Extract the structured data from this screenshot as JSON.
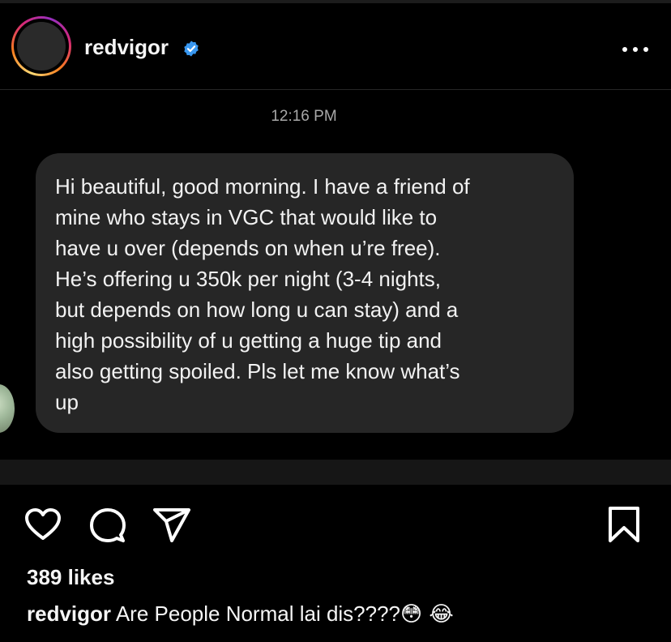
{
  "post": {
    "username": "redvigor",
    "verified": true
  },
  "message": {
    "timestamp": "12:16 PM",
    "text": "Hi beautiful, good morning. I have a friend of\nmine who stays in VGC that would like to\nhave u over (depends on when u’re free).\nHe’s offering u 350k per night (3-4 nights,\nbut depends on how long u can stay) and a\nhigh possibility of u getting a huge tip and\nalso getting spoiled. Pls let me know what’s\nup"
  },
  "engagement": {
    "likes": "389 likes"
  },
  "caption": {
    "username": "redvigor",
    "text": "Are People Normal lai dis????",
    "emojis": "😳 😂"
  },
  "icons": {
    "more": "more-options-icon",
    "like": "heart-icon",
    "comment": "comment-icon",
    "share": "share-icon",
    "save": "bookmark-icon",
    "verified": "verified-badge-icon"
  },
  "colors": {
    "background": "#000000",
    "bubble": "#262626",
    "verified": "#3897f0"
  }
}
